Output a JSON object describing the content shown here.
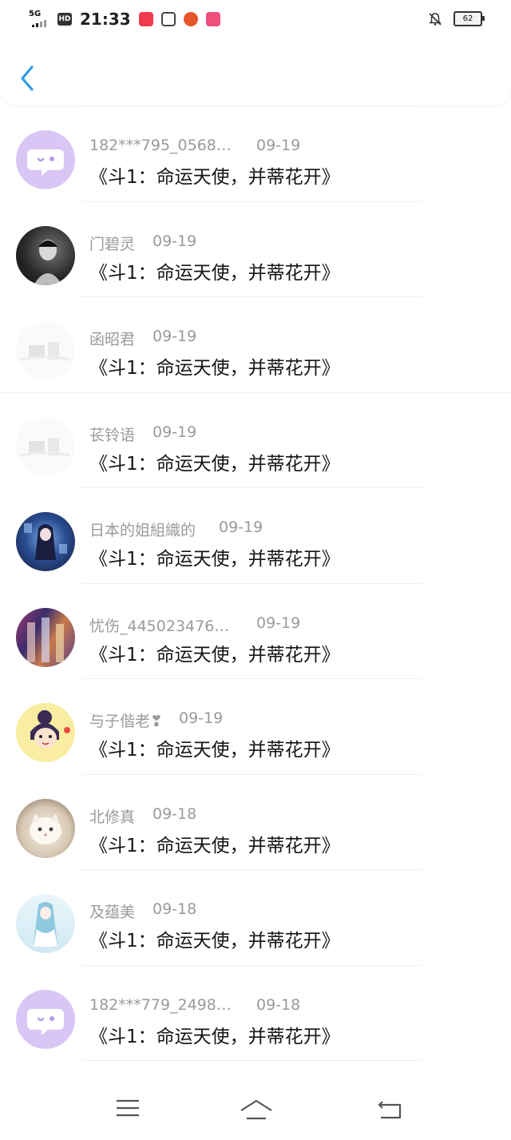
{
  "status_bar": {
    "network": "5G",
    "hd": "HD",
    "time": "21:33",
    "battery": "62",
    "app_icons": [
      "app-icon-red",
      "app-icon-dark",
      "app-icon-orange",
      "app-icon-pink"
    ]
  },
  "header": {
    "back_icon": "chevron-left-icon"
  },
  "comments": [
    {
      "name": "182***795_0568…",
      "date": "09-19",
      "text": "《斗1：命运天使，并蒂花开》",
      "avatar": "chat-bubble-purple"
    },
    {
      "name": "门碧灵",
      "date": "09-19",
      "text": "《斗1：命运天使，并蒂花开》",
      "avatar": "photo-dark-portrait"
    },
    {
      "name": "函昭君",
      "date": "09-19",
      "text": "《斗1：命运天使，并蒂花开》",
      "avatar": "faded-illustration"
    },
    {
      "name": "苌铃语",
      "date": "09-19",
      "text": "《斗1：命运天使，并蒂花开》",
      "avatar": "faded-illustration"
    },
    {
      "name": "日本的姐組織的",
      "date": "09-19",
      "text": "《斗1：命运天使，并蒂花开》",
      "avatar": "anime-blue-night"
    },
    {
      "name": "忧伤_445023476…",
      "date": "09-19",
      "text": "《斗1：命运天使，并蒂花开》",
      "avatar": "anime-colorful-group"
    },
    {
      "name": "与子偕老❣",
      "date": "09-19",
      "text": "《斗1：命运天使，并蒂花开》",
      "avatar": "cartoon-girl-yellow"
    },
    {
      "name": "北修真",
      "date": "09-18",
      "text": "《斗1：命运天使，并蒂花开》",
      "avatar": "white-cat-photo"
    },
    {
      "name": "及蕴美",
      "date": "09-18",
      "text": "《斗1：命运天使，并蒂花开》",
      "avatar": "anime-light-blue"
    },
    {
      "name": "182***779_2498…",
      "date": "09-18",
      "text": "《斗1：命运天使，并蒂花开》",
      "avatar": "chat-bubble-purple"
    }
  ],
  "nav_bar": {
    "icons": [
      "menu-icon",
      "home-icon",
      "back-nav-icon"
    ]
  },
  "colors": {
    "accent": "#2f9be6",
    "avatar_purple": "#d9c6f5",
    "meta_gray": "#9a9a9a"
  }
}
